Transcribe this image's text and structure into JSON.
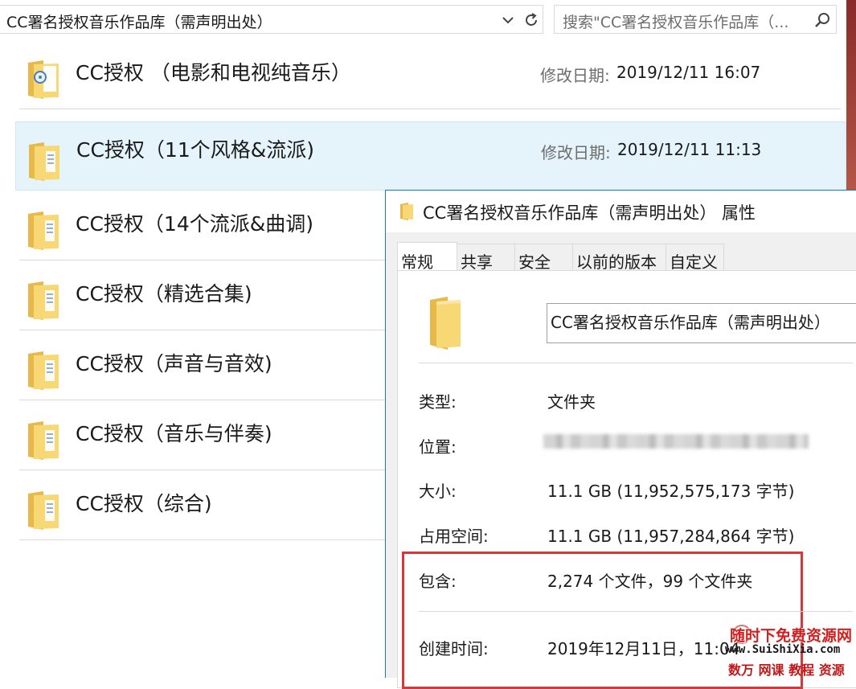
{
  "explorer": {
    "address_path": "CC署名授权音乐作品库（需声明出处）",
    "search_placeholder": "搜索\"CC署名授权音乐作品库（...",
    "modified_label": "修改日期:",
    "items": [
      {
        "name": "CC授权 （电影和电视纯音乐）",
        "modified": "2019/12/11 16:07",
        "icon": "folder-with-disc-icon"
      },
      {
        "name": "CC授权（11个风格&流派)",
        "modified": "2019/12/11 11:13",
        "icon": "folder-icon",
        "selected": true
      },
      {
        "name": "CC授权（14个流派&曲调)",
        "icon": "folder-icon"
      },
      {
        "name": "CC授权（精选合集)",
        "icon": "folder-icon"
      },
      {
        "name": "CC授权（声音与音效)",
        "icon": "folder-icon"
      },
      {
        "name": "CC授权（音乐与伴奏)",
        "icon": "folder-icon"
      },
      {
        "name": "CC授权（综合)",
        "icon": "folder-icon"
      }
    ]
  },
  "dialog": {
    "title": "CC署名授权音乐作品库（需声明出处）  属性",
    "tabs": [
      "常规",
      "共享",
      "安全",
      "以前的版本",
      "自定义"
    ],
    "active_tab": "常规",
    "folder_name": "CC署名授权音乐作品库（需声明出处）",
    "type_label": "类型:",
    "type_value": "文件夹",
    "location_label": "位置:",
    "size_label": "大小:",
    "size_value": "11.1 GB (11,952,575,173 字节)",
    "disk_label": "占用空间:",
    "disk_value": "11.1 GB (11,957,284,864 字节)",
    "contains_label": "包含:",
    "contains_value": "2,274 个文件，99 个文件夹",
    "created_label": "创建时间:",
    "created_value": "2019年12月11日，11:04"
  },
  "watermark": {
    "line1": "随时下免费资源网",
    "line2": "www.SuiShiXia.com",
    "line3": "数万 网课 教程 资源"
  },
  "colors": {
    "selection": "#e5f3fb",
    "dialog_border": "#1979ca",
    "highlight_box": "#d6383a",
    "folder": "#f8d775"
  }
}
